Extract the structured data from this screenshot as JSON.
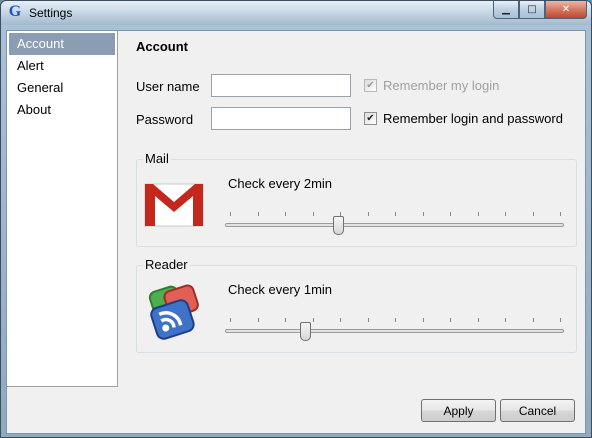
{
  "window": {
    "title": "Settings",
    "icon": "google-g-icon",
    "controls": [
      "minimize-icon",
      "maximize-icon",
      "close-icon"
    ]
  },
  "sidebar": {
    "items": [
      {
        "label": "Account",
        "selected": true
      },
      {
        "label": "Alert",
        "selected": false
      },
      {
        "label": "General",
        "selected": false
      },
      {
        "label": "About",
        "selected": false
      }
    ]
  },
  "account": {
    "title": "Account",
    "username_label": "User name",
    "username_value": "",
    "password_label": "Password",
    "password_value": "",
    "remember_login_label": "Remember my login",
    "remember_login_checked": true,
    "remember_login_enabled": false,
    "remember_both_label": "Remember login and password",
    "remember_both_checked": true
  },
  "mail": {
    "group_label": "Mail",
    "icon": "gmail-icon",
    "check_text": "Check every 2min",
    "slider_value": 0.33,
    "tick_count": 13
  },
  "reader": {
    "group_label": "Reader",
    "icon": "google-reader-icon",
    "check_text": "Check every 1min",
    "slider_value": 0.23,
    "tick_count": 13
  },
  "buttons": {
    "apply": "Apply",
    "cancel": "Cancel"
  },
  "colors": {
    "selected_item_bg": "#8a9db2",
    "gmail_red": "#c4281c",
    "reader_blue": "#3f73c8"
  }
}
